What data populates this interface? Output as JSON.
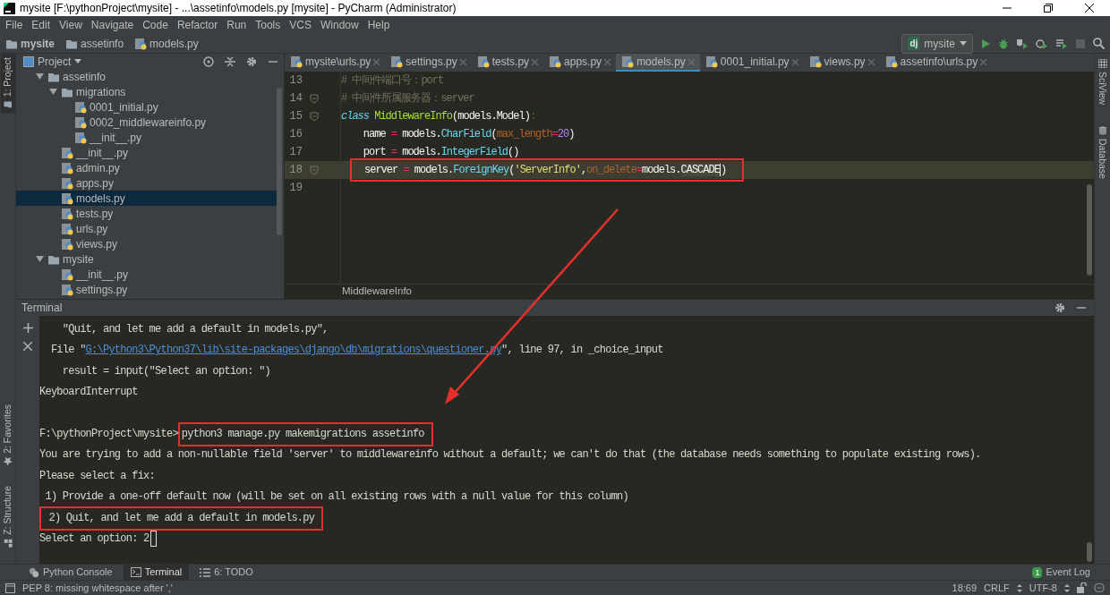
{
  "window": {
    "title": "mysite [F:\\pythonProject\\mysite] - ...\\assetinfo\\models.py [mysite] - PyCharm (Administrator)"
  },
  "menu": [
    "File",
    "Edit",
    "View",
    "Navigate",
    "Code",
    "Refactor",
    "Run",
    "Tools",
    "VCS",
    "Window",
    "Help"
  ],
  "breadcrumbs": [
    {
      "label": "mysite",
      "kind": "folder"
    },
    {
      "label": "assetinfo",
      "kind": "folder"
    },
    {
      "label": "models.py",
      "kind": "python"
    }
  ],
  "run_config": {
    "badge": "dj",
    "label": "mysite"
  },
  "side_strips": {
    "left_top": [
      {
        "label": "1: Project",
        "selected": true
      }
    ],
    "left_bottom": [
      {
        "label": "2: Favorites",
        "selected": false
      },
      {
        "label": "Z: Structure",
        "selected": false
      }
    ],
    "right": [
      {
        "label": "SciView",
        "selected": false
      },
      {
        "label": "Database",
        "selected": false
      }
    ]
  },
  "project_panel": {
    "title": "Project",
    "tree": [
      {
        "label": "assetinfo",
        "kind": "folder",
        "expanded": true,
        "selected": false,
        "children": [
          {
            "label": "migrations",
            "kind": "folder",
            "expanded": true,
            "selected": false,
            "children": [
              {
                "label": "0001_initial.py",
                "kind": "python",
                "selected": false
              },
              {
                "label": "0002_middlewareinfo.py",
                "kind": "python",
                "selected": false
              },
              {
                "label": "__init__.py",
                "kind": "python",
                "selected": false
              }
            ]
          },
          {
            "label": "__init__.py",
            "kind": "python",
            "selected": false
          },
          {
            "label": "admin.py",
            "kind": "python",
            "selected": false
          },
          {
            "label": "apps.py",
            "kind": "python",
            "selected": false
          },
          {
            "label": "models.py",
            "kind": "python",
            "selected": true
          },
          {
            "label": "tests.py",
            "kind": "python",
            "selected": false
          },
          {
            "label": "urls.py",
            "kind": "python",
            "selected": false
          },
          {
            "label": "views.py",
            "kind": "python",
            "selected": false
          }
        ]
      },
      {
        "label": "mysite",
        "kind": "folder",
        "expanded": true,
        "selected": false,
        "children": [
          {
            "label": "__init__.py",
            "kind": "python",
            "selected": false
          },
          {
            "label": "settings.py",
            "kind": "python",
            "selected": false
          }
        ]
      }
    ]
  },
  "editor": {
    "tabs": [
      {
        "label": "mysite\\urls.py",
        "selected": false
      },
      {
        "label": "settings.py",
        "selected": false
      },
      {
        "label": "tests.py",
        "selected": false
      },
      {
        "label": "apps.py",
        "selected": false
      },
      {
        "label": "models.py",
        "selected": true
      },
      {
        "label": "0001_initial.py",
        "selected": false
      },
      {
        "label": "views.py",
        "selected": false
      },
      {
        "label": "assetinfo\\urls.py",
        "selected": false
      }
    ],
    "lines": [
      {
        "number": "13",
        "tokens": [
          {
            "text": "# 中间件端口号：port",
            "kind": "comment"
          }
        ]
      },
      {
        "number": "14",
        "fold": true,
        "tokens": [
          {
            "text": "# 中间件所属服务器：server",
            "kind": "comment"
          }
        ]
      },
      {
        "number": "15",
        "fold": true,
        "tokens": [
          {
            "text": "class",
            "kind": "keyword"
          },
          {
            "text": " MiddlewareInfo",
            "kind": "classname"
          },
          {
            "text": "(models.Model)",
            "kind": "plain"
          },
          {
            "text": ":",
            "kind": "dim"
          }
        ]
      },
      {
        "number": "16",
        "tokens": [
          {
            "text": "    name ",
            "kind": "plain"
          },
          {
            "text": "=",
            "kind": "op"
          },
          {
            "text": " models.",
            "kind": "plain"
          },
          {
            "text": "CharField",
            "kind": "call"
          },
          {
            "text": "(",
            "kind": "plain"
          },
          {
            "text": "max_length",
            "kind": "param"
          },
          {
            "text": "=",
            "kind": "op"
          },
          {
            "text": "20",
            "kind": "number"
          },
          {
            "text": ")",
            "kind": "plain"
          }
        ]
      },
      {
        "number": "17",
        "tokens": [
          {
            "text": "    port ",
            "kind": "plain"
          },
          {
            "text": "=",
            "kind": "op"
          },
          {
            "text": " models.",
            "kind": "plain"
          },
          {
            "text": "IntegerField",
            "kind": "call"
          },
          {
            "text": "()",
            "kind": "plain"
          }
        ]
      },
      {
        "number": "18",
        "fold": true,
        "current": true,
        "highlighted": true,
        "tokens": [
          {
            "text": "server ",
            "kind": "plain"
          },
          {
            "text": "=",
            "kind": "op"
          },
          {
            "text": " models.",
            "kind": "plain"
          },
          {
            "text": "ForeignKey",
            "kind": "call"
          },
          {
            "text": "(",
            "kind": "plain"
          },
          {
            "text": "'ServerInfo'",
            "kind": "string"
          },
          {
            "text": ",",
            "kind": "plain"
          },
          {
            "text": "on_delete",
            "kind": "param"
          },
          {
            "text": "=",
            "kind": "op"
          },
          {
            "text": "models.",
            "kind": "plain"
          },
          {
            "text": "CASCADE",
            "kind": "plain",
            "selected": true
          },
          {
            "text": ")",
            "kind": "plain"
          }
        ]
      },
      {
        "number": "19"
      }
    ],
    "breadcrumb": "MiddlewareInfo"
  },
  "terminal": {
    "title": "Terminal",
    "lines": [
      {
        "kind": "text",
        "segments": [
          {
            "text": "    \"Quit, and let me add a default in models.py\","
          }
        ]
      },
      {
        "kind": "text",
        "segments": [
          {
            "text": "  File \""
          },
          {
            "text": "G:\\Python3\\Python37\\lib\\site-packages\\django\\db\\migrations\\questioner.py",
            "kind": "link"
          },
          {
            "text": "\", line 97, in _choice_input"
          }
        ]
      },
      {
        "kind": "text",
        "segments": [
          {
            "text": "    result = input(\"Select an option: \")"
          }
        ]
      },
      {
        "kind": "text",
        "segments": [
          {
            "text": "KeyboardInterrupt"
          }
        ]
      },
      {
        "kind": "blank"
      },
      {
        "kind": "text",
        "segments": [
          {
            "text": "F:\\pythonProject\\mysite>"
          },
          {
            "text": "python3 manage.py makemigrations assetinfo",
            "highlighted": true
          }
        ]
      },
      {
        "kind": "text",
        "segments": [
          {
            "text": "You are trying to add a non-nullable field 'server' to middlewareinfo without a default; we can't do that (the database needs something to populate existing rows)."
          }
        ]
      },
      {
        "kind": "text",
        "segments": [
          {
            "text": "Please select a fix:"
          }
        ]
      },
      {
        "kind": "text",
        "segments": [
          {
            "text": " 1) Provide a one-off default now (will be set on all existing rows with a null value for this column)"
          }
        ]
      },
      {
        "kind": "text",
        "segments": [
          {
            "text": " 2) Quit, and let me add a default in models.py",
            "highlighted": true
          }
        ]
      },
      {
        "kind": "text",
        "cursor": true,
        "segments": [
          {
            "text": "Select an option: 2"
          }
        ]
      }
    ]
  },
  "bottom_tabs": [
    {
      "label": "Python Console",
      "selected": false
    },
    {
      "label": "Terminal",
      "selected": true
    },
    {
      "label": "6: TODO",
      "selected": false
    }
  ],
  "event_log": {
    "label": "Event Log",
    "count": "1"
  },
  "status_bar": {
    "message": "PEP 8: missing whitespace after ','",
    "position": "18:69",
    "line_separator": "CRLF",
    "encoding": "UTF-8"
  },
  "callout_arrow": true
}
